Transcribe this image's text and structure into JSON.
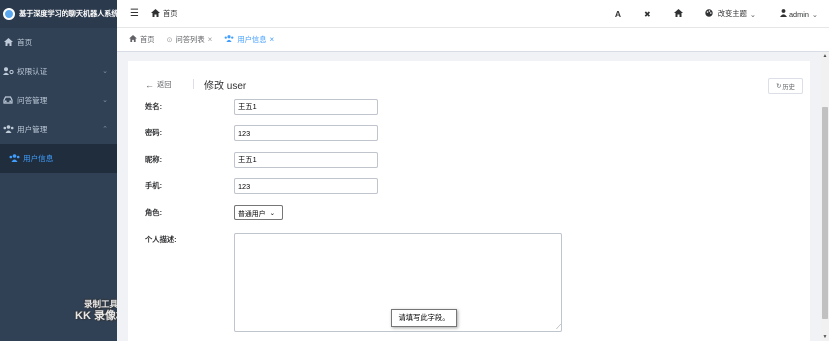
{
  "app": {
    "title": "基于深度学习的聊天机器人系统"
  },
  "sidebar": {
    "items": [
      {
        "label": "首页",
        "icon": "home-icon"
      },
      {
        "label": "权限认证",
        "icon": "user-key-icon",
        "arrow": "⌄"
      },
      {
        "label": "问答管理",
        "icon": "car-icon",
        "arrow": "⌄"
      },
      {
        "label": "用户管理",
        "icon": "users-icon",
        "arrow": "⌃"
      },
      {
        "label": "用户信息",
        "icon": "users-icon"
      }
    ]
  },
  "watermark": {
    "line1": "录制工具",
    "line2": "KK 录像机"
  },
  "navbar": {
    "breadcrumb": "首页",
    "font_icon": "A",
    "fullscreen_icon": "✖",
    "home_icon": "⌂",
    "theme_label": "改变主题",
    "user_label": "admin",
    "dropdown_arrow": "⌄"
  },
  "tags": [
    {
      "label": "首页",
      "icon": "home-icon"
    },
    {
      "label": "问答列表",
      "icon": "circle-icon",
      "close": "×"
    },
    {
      "label": "用户信息",
      "icon": "users-icon",
      "close": "×",
      "active": true
    }
  ],
  "page": {
    "back_label": "返回",
    "title": "修改 user",
    "history_label": "历史"
  },
  "form": {
    "name": {
      "label": "姓名:",
      "value": "王五1"
    },
    "password": {
      "label": "密码:",
      "value": "123"
    },
    "nickname": {
      "label": "昵称:",
      "value": "王五1"
    },
    "phone": {
      "label": "手机:",
      "value": "123"
    },
    "role": {
      "label": "角色:",
      "value": "普通用户"
    },
    "bio": {
      "label": "个人描述:",
      "value": ""
    }
  },
  "tooltip": {
    "text": "请填写此字段。"
  },
  "colors": {
    "sidebar_bg": "#304156",
    "sidebar_active_text": "#409eff",
    "accent": "#409eff"
  }
}
